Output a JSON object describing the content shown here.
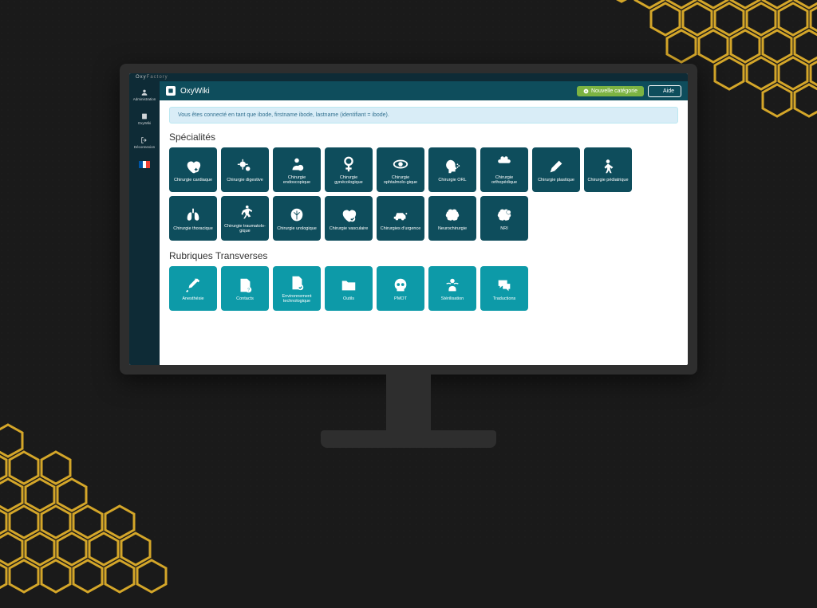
{
  "brand": {
    "prefix": "Oxy",
    "suffix": "Factory"
  },
  "header": {
    "title": "OxyWiki",
    "new_category_label": "Nouvelle catégorie",
    "help_label": "Aide"
  },
  "sidebar": {
    "items": [
      {
        "label": "Administration",
        "icon": "user"
      },
      {
        "label": "OxyWiki",
        "icon": "book"
      },
      {
        "label": "Déconnexion",
        "icon": "signout"
      }
    ]
  },
  "alert": {
    "text": "Vous êtes connecté en tant que ibode, firstname ibode, lastname (identifiant = ibode)."
  },
  "sections": [
    {
      "title": "Spécialités",
      "style": "dark",
      "tiles": [
        {
          "label": "Chirurgie cardiaque",
          "icon": "heart"
        },
        {
          "label": "Chirurgie digestive",
          "icon": "gears"
        },
        {
          "label": "Chirurgie endoscopique",
          "icon": "person-circle"
        },
        {
          "label": "Chirurgie gynécologique",
          "icon": "female"
        },
        {
          "label": "Chirurgie ophtalmolo-gique",
          "icon": "eye"
        },
        {
          "label": "Chirurgie ORL",
          "icon": "head"
        },
        {
          "label": "Chirurgie orthopédique",
          "icon": "bone"
        },
        {
          "label": "Chirurgie plastique",
          "icon": "pen"
        },
        {
          "label": "Chirurgie pédiatrique",
          "icon": "child"
        },
        {
          "label": "Chirurgie thoracique",
          "icon": "lungs"
        },
        {
          "label": "Chirurgie traumatolo-gique",
          "icon": "running"
        },
        {
          "label": "Chirurgie urologique",
          "icon": "kidney"
        },
        {
          "label": "Chirurgie vasculaire",
          "icon": "heart-check"
        },
        {
          "label": "Chirurgies d'urgence",
          "icon": "ambulance"
        },
        {
          "label": "Neurochirurgie",
          "icon": "brain"
        },
        {
          "label": "NRI",
          "icon": "brain-gear"
        }
      ]
    },
    {
      "title": "Rubriques Transverses",
      "style": "teal",
      "tiles": [
        {
          "label": "Anesthésie",
          "icon": "syringe"
        },
        {
          "label": "Contacts",
          "icon": "file-question"
        },
        {
          "label": "Environnement technologique",
          "icon": "file-check"
        },
        {
          "label": "Outils",
          "icon": "folder"
        },
        {
          "label": "PMOT",
          "icon": "skull"
        },
        {
          "label": "Stérilisation",
          "icon": "waves"
        },
        {
          "label": "Traductions",
          "icon": "chat"
        }
      ]
    }
  ]
}
